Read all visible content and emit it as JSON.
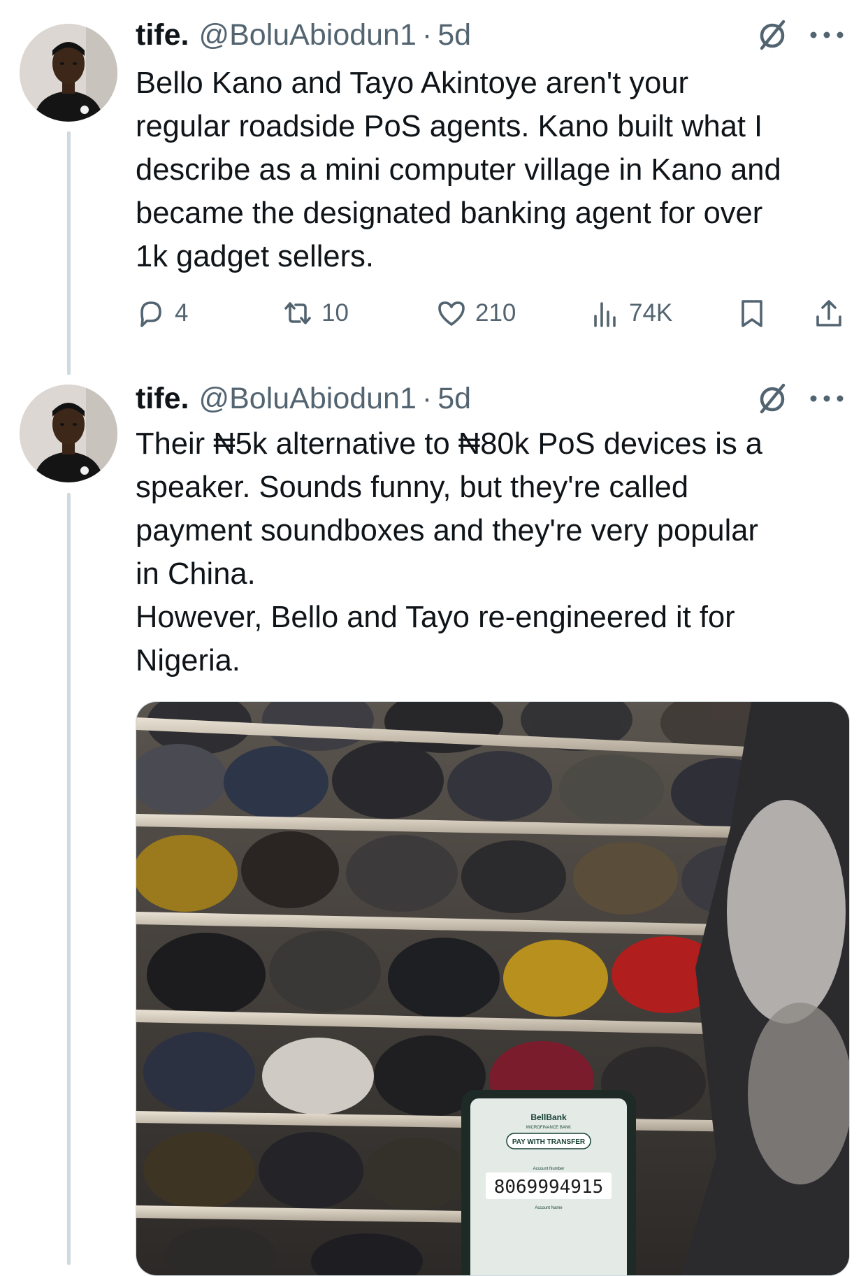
{
  "tweets": [
    {
      "name": "tife.",
      "handle": "@BoluAbiodun1",
      "separator": "·",
      "time": "5d",
      "text": "Bello Kano and Tayo Akintoye aren't your\nregular roadside PoS agents. Kano built what I\ndescribe as a mini computer village in Kano and\nbecame the designated banking agent for over\n1k gadget sellers.",
      "replies": "4",
      "reposts": "10",
      "likes": "210",
      "views": "74K"
    },
    {
      "name": "tife.",
      "handle": "@BoluAbiodun1",
      "separator": "·",
      "time": "5d",
      "text": "Their ₦5k alternative to ₦80k PoS devices is a\nspeaker. Sounds funny, but they're called\npayment soundboxes and they're very popular\nin China.\nHowever, Bello and Tayo re-engineered it for\nNigeria.",
      "media": {
        "device_brand": "BellBank",
        "device_subtitle": "MICROFINANCE BANK",
        "device_button": "PAY WITH TRANSFER",
        "account_number_label": "Account Number",
        "account_number": "8069994915",
        "account_name_label": "Account Name"
      }
    }
  ],
  "icons": {
    "grok": "grok-icon",
    "more": "more-icon",
    "reply": "reply-icon",
    "repost": "repost-icon",
    "like": "like-icon",
    "views": "views-icon",
    "bookmark": "bookmark-icon",
    "share": "share-icon"
  },
  "colors": {
    "text": "#0f1419",
    "secondary": "#536471",
    "thread_line": "#cfd9de"
  }
}
